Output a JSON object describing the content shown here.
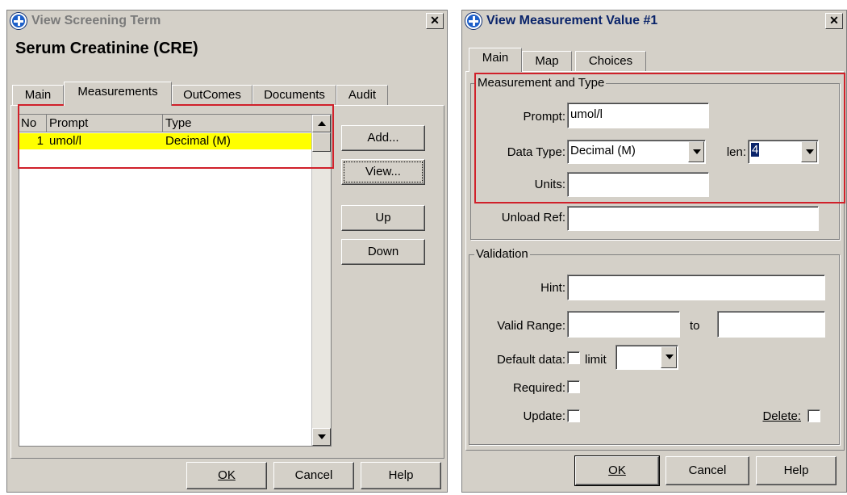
{
  "left": {
    "window_title": "View Screening Term",
    "heading": "Serum Creatinine (CRE)",
    "tabs": [
      "Main",
      "Measurements",
      "OutComes",
      "Documents",
      "Audit"
    ],
    "grid": {
      "columns": [
        "No",
        "Prompt",
        "Type"
      ],
      "rows": [
        {
          "no": "1",
          "prompt": "umol/l",
          "type": "Decimal (M)"
        }
      ]
    },
    "side_buttons": {
      "add": "Add...",
      "view": "View...",
      "up": "Up",
      "down": "Down"
    },
    "footer": {
      "ok": "OK",
      "cancel": "Cancel",
      "help": "Help"
    }
  },
  "right": {
    "window_title": "View Measurement Value #1",
    "tabs": [
      "Main",
      "Map",
      "Choices"
    ],
    "measurement_group": "Measurement and Type",
    "prompt_label": "Prompt:",
    "prompt_value": "umol/l",
    "datatype_label": "Data Type:",
    "datatype_value": "Decimal (M)",
    "len_label": "len:",
    "len_value": "4",
    "units_label": "Units:",
    "units_value": "",
    "unload_label": "Unload Ref:",
    "unload_value": "",
    "validation_group": "Validation",
    "hint_label": "Hint:",
    "hint_value": "",
    "range_label": "Valid Range:",
    "range_from": "",
    "range_to_label": "to",
    "range_to": "",
    "default_label": "Default data:",
    "limit_label": "limit",
    "limit_value": "",
    "required_label": "Required:",
    "update_label": "Update:",
    "delete_label": "Delete:",
    "footer": {
      "ok": "OK",
      "cancel": "Cancel",
      "help": "Help"
    }
  },
  "colors": {
    "selected_row": "#ffff00",
    "highlight_box": "#d0202a",
    "title_text_inactive": "#7a7a7a",
    "title_text_active": "#0a246a"
  }
}
